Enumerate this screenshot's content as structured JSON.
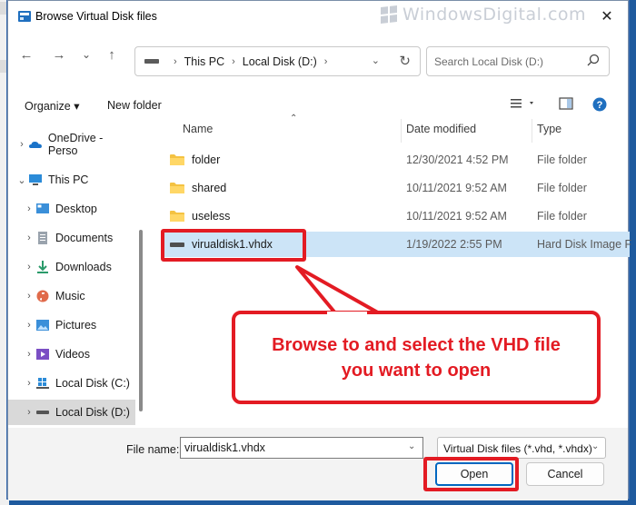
{
  "dialog": {
    "title": "Browse Virtual Disk files",
    "close_glyph": "✕",
    "watermark": "WindowsDigital.com"
  },
  "nav": {
    "back_glyph": "←",
    "forward_glyph": "→",
    "history_glyph": "⌄",
    "up_glyph": "↑",
    "breadcrumb": [
      "This PC",
      "Local Disk (D:)"
    ],
    "search_placeholder": "Search Local Disk (D:)"
  },
  "toolbar": {
    "organize": "Organize ▾",
    "new_folder": "New folder"
  },
  "sidebar": {
    "items": [
      {
        "label": "OneDrive - Perso",
        "icon": "cloud-icon",
        "expand": "›",
        "indent": 1
      },
      {
        "label": "This PC",
        "icon": "computer-icon",
        "expand": "⌄",
        "indent": 1
      },
      {
        "label": "Desktop",
        "icon": "desktop-icon",
        "expand": "›",
        "indent": 2
      },
      {
        "label": "Documents",
        "icon": "documents-icon",
        "expand": "›",
        "indent": 2
      },
      {
        "label": "Downloads",
        "icon": "download-icon",
        "expand": "›",
        "indent": 2
      },
      {
        "label": "Music",
        "icon": "music-icon",
        "expand": "›",
        "indent": 2
      },
      {
        "label": "Pictures",
        "icon": "pictures-icon",
        "expand": "›",
        "indent": 2
      },
      {
        "label": "Videos",
        "icon": "videos-icon",
        "expand": "›",
        "indent": 2
      },
      {
        "label": "Local Disk (C:)",
        "icon": "drive-icon",
        "expand": "›",
        "indent": 2
      },
      {
        "label": "Local Disk (D:)",
        "icon": "drive-icon",
        "expand": "›",
        "indent": 2,
        "selected": true
      }
    ]
  },
  "columns": {
    "name": "Name",
    "date": "Date modified",
    "type": "Type"
  },
  "files": [
    {
      "name": "folder",
      "date": "12/30/2021 4:52 PM",
      "type": "File folder",
      "kind": "folder"
    },
    {
      "name": "shared",
      "date": "10/11/2021 9:52 AM",
      "type": "File folder",
      "kind": "folder"
    },
    {
      "name": "useless",
      "date": "10/11/2021 9:52 AM",
      "type": "File folder",
      "kind": "folder"
    },
    {
      "name": "virualdisk1.vhdx",
      "date": "1/19/2022 2:55 PM",
      "type": "Hard Disk Image F",
      "kind": "vhd",
      "selected": true
    }
  ],
  "footer": {
    "file_name_label": "File name:",
    "file_name_value": "virualdisk1.vhdx",
    "filter": "Virtual Disk files (*.vhd, *.vhdx)",
    "open": "Open",
    "cancel": "Cancel"
  },
  "annotation": {
    "text": "Browse to and select the VHD file you want to open",
    "color": "#e31b23"
  }
}
